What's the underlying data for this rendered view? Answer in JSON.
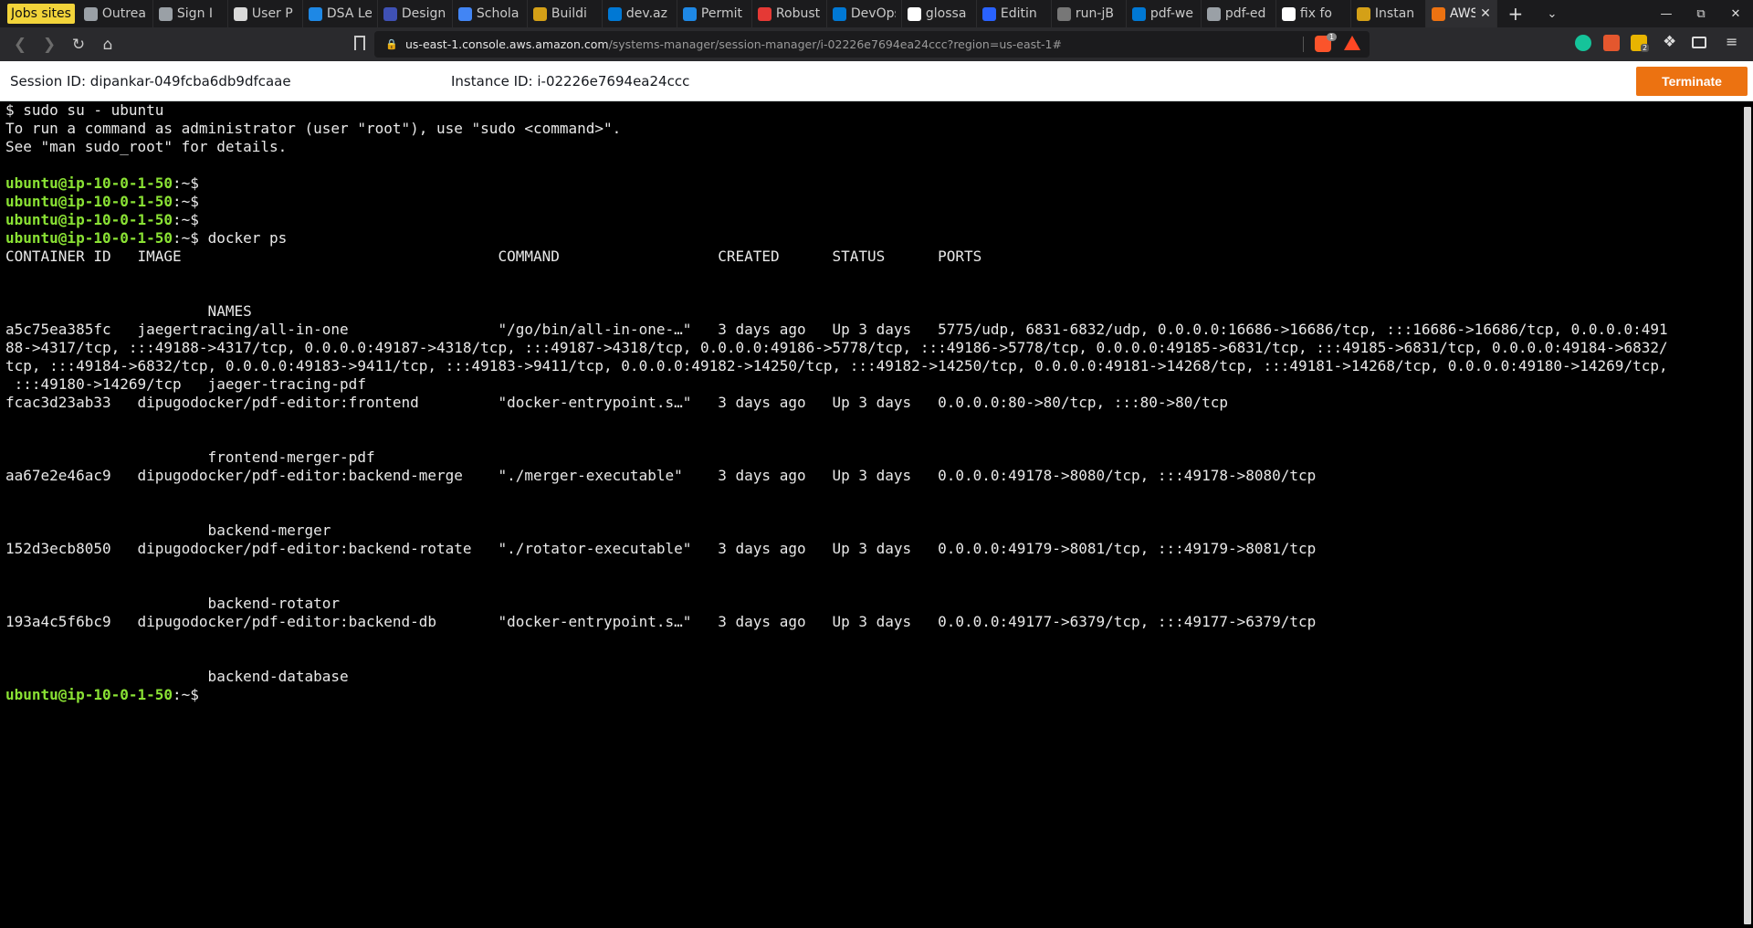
{
  "browser": {
    "tabs": [
      {
        "label": "Jobs sites",
        "pinned": true,
        "icon": "folder-icon"
      },
      {
        "label": "Outrea",
        "icon": "globe-icon",
        "color": "#9aa0a6"
      },
      {
        "label": "Sign I",
        "icon": "globe-icon",
        "color": "#9aa0a6"
      },
      {
        "label": "User P",
        "icon": "user-icon",
        "color": "#d9d9d9"
      },
      {
        "label": "DSA Le",
        "icon": "check-icon",
        "color": "#1e88e5"
      },
      {
        "label": "Design",
        "icon": "diagram-icon",
        "color": "#3f51b5"
      },
      {
        "label": "Schola",
        "icon": "scholar-icon",
        "color": "#4285f4"
      },
      {
        "label": "Buildi",
        "icon": "package-icon",
        "color": "#d4a017"
      },
      {
        "label": "dev.az",
        "icon": "devops-icon",
        "color": "#0078d4"
      },
      {
        "label": "Permit",
        "icon": "permit-icon",
        "color": "#1e88e5"
      },
      {
        "label": "Robust",
        "icon": "lifebuoy-icon",
        "color": "#e53935"
      },
      {
        "label": "DevOps",
        "icon": "devops-icon",
        "color": "#0078d4"
      },
      {
        "label": "glossa",
        "icon": "github-icon",
        "color": "#ffffff"
      },
      {
        "label": "Editin",
        "icon": "diamond-icon",
        "color": "#2962ff"
      },
      {
        "label": "run-jB",
        "icon": "fork-icon",
        "color": "#777777"
      },
      {
        "label": "pdf-we",
        "icon": "azure-icon",
        "color": "#0078d4"
      },
      {
        "label": "pdf-ed",
        "icon": "globe-icon",
        "color": "#9aa0a6"
      },
      {
        "label": "fix fo",
        "icon": "github-icon",
        "color": "#ffffff"
      },
      {
        "label": "Instan",
        "icon": "package-icon",
        "color": "#d4a017"
      },
      {
        "label": "AWS",
        "icon": "aws-cube-icon",
        "color": "#ec7211",
        "active": true
      }
    ],
    "new_tab": "+",
    "url_host": "us-east-1.console.aws.amazon.com",
    "url_path": "/systems-manager/session-manager/i-02226e7694ea24ccc?region=us-east-1#",
    "brave_badge": "1",
    "wallet_badge": "2"
  },
  "session": {
    "session_id": "Session ID: dipankar-049fcba6db9dfcaae",
    "instance_id": "Instance ID: i-02226e7694ea24ccc",
    "terminate_label": "Terminate",
    "terminate_color": "#ec7211"
  },
  "terminal": {
    "prompt": "ubuntu@ip-10-0-1-50",
    "lines": [
      {
        "text": "$ sudo su - ubuntu"
      },
      {
        "text": "To run a command as administrator (user \"root\"), use \"sudo <command>\"."
      },
      {
        "text": "See \"man sudo_root\" for details."
      },
      {
        "text": ""
      },
      {
        "prompt": true,
        "text": "~$"
      },
      {
        "prompt": true,
        "text": "~$"
      },
      {
        "prompt": true,
        "text": "~$"
      },
      {
        "prompt": true,
        "text": "~$ docker ps"
      },
      {
        "text": "CONTAINER ID   IMAGE                                    COMMAND                  CREATED      STATUS      PORTS"
      },
      {
        "text": ""
      },
      {
        "text": ""
      },
      {
        "text": "                       NAMES"
      },
      {
        "text": "a5c75ea385fc   jaegertracing/all-in-one                 \"/go/bin/all-in-one-…\"   3 days ago   Up 3 days   5775/udp, 6831-6832/udp, 0.0.0.0:16686->16686/tcp, :::16686->16686/tcp, 0.0.0.0:491"
      },
      {
        "text": "88->4317/tcp, :::49188->4317/tcp, 0.0.0.0:49187->4318/tcp, :::49187->4318/tcp, 0.0.0.0:49186->5778/tcp, :::49186->5778/tcp, 0.0.0.0:49185->6831/tcp, :::49185->6831/tcp, 0.0.0.0:49184->6832/"
      },
      {
        "text": "tcp, :::49184->6832/tcp, 0.0.0.0:49183->9411/tcp, :::49183->9411/tcp, 0.0.0.0:49182->14250/tcp, :::49182->14250/tcp, 0.0.0.0:49181->14268/tcp, :::49181->14268/tcp, 0.0.0.0:49180->14269/tcp,"
      },
      {
        "text": " :::49180->14269/tcp   jaeger-tracing-pdf"
      },
      {
        "text": "fcac3d23ab33   dipugodocker/pdf-editor:frontend         \"docker-entrypoint.s…\"   3 days ago   Up 3 days   0.0.0.0:80->80/tcp, :::80->80/tcp"
      },
      {
        "text": ""
      },
      {
        "text": ""
      },
      {
        "text": "                       frontend-merger-pdf"
      },
      {
        "text": "aa67e2e46ac9   dipugodocker/pdf-editor:backend-merge    \"./merger-executable\"    3 days ago   Up 3 days   0.0.0.0:49178->8080/tcp, :::49178->8080/tcp"
      },
      {
        "text": ""
      },
      {
        "text": ""
      },
      {
        "text": "                       backend-merger"
      },
      {
        "text": "152d3ecb8050   dipugodocker/pdf-editor:backend-rotate   \"./rotator-executable\"   3 days ago   Up 3 days   0.0.0.0:49179->8081/tcp, :::49179->8081/tcp"
      },
      {
        "text": ""
      },
      {
        "text": ""
      },
      {
        "text": "                       backend-rotator"
      },
      {
        "text": "193a4c5f6bc9   dipugodocker/pdf-editor:backend-db       \"docker-entrypoint.s…\"   3 days ago   Up 3 days   0.0.0.0:49177->6379/tcp, :::49177->6379/tcp"
      },
      {
        "text": ""
      },
      {
        "text": ""
      },
      {
        "text": "                       backend-database"
      },
      {
        "prompt": true,
        "text": "~$"
      }
    ]
  }
}
